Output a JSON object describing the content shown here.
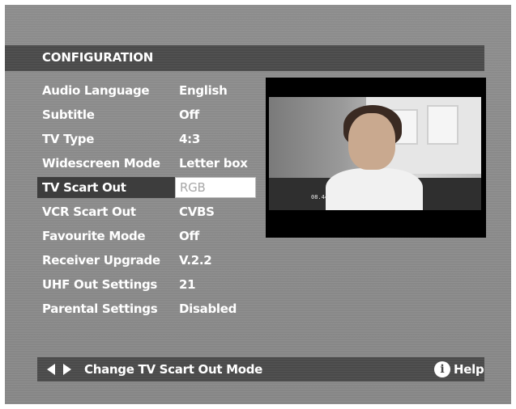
{
  "header": {
    "title": "CONFIGURATION"
  },
  "menu": {
    "items": [
      {
        "label": "Audio Language",
        "value": "English"
      },
      {
        "label": "Subtitle",
        "value": "Off"
      },
      {
        "label": "TV Type",
        "value": "4:3"
      },
      {
        "label": "Widescreen Mode",
        "value": "Letter box"
      },
      {
        "label": "TV Scart Out",
        "value": "RGB",
        "selected": true
      },
      {
        "label": "VCR Scart Out",
        "value": "CVBS"
      },
      {
        "label": "Favourite Mode",
        "value": "Off"
      },
      {
        "label": "Receiver Upgrade",
        "value": "V.2.2"
      },
      {
        "label": "UHF Out Settings",
        "value": "21"
      },
      {
        "label": "Parental Settings",
        "value": "Disabled"
      }
    ]
  },
  "preview": {
    "timecode": "08.44"
  },
  "footer": {
    "hint": "Change TV Scart Out Mode",
    "help_icon_glyph": "i",
    "help_label": "Help"
  },
  "colors": {
    "background": "#8a8a8a",
    "bar": "#4a4a4a",
    "text": "#ffffff",
    "selected_value_box": "#ffffff",
    "selected_value_text": "#a8a8a8"
  }
}
